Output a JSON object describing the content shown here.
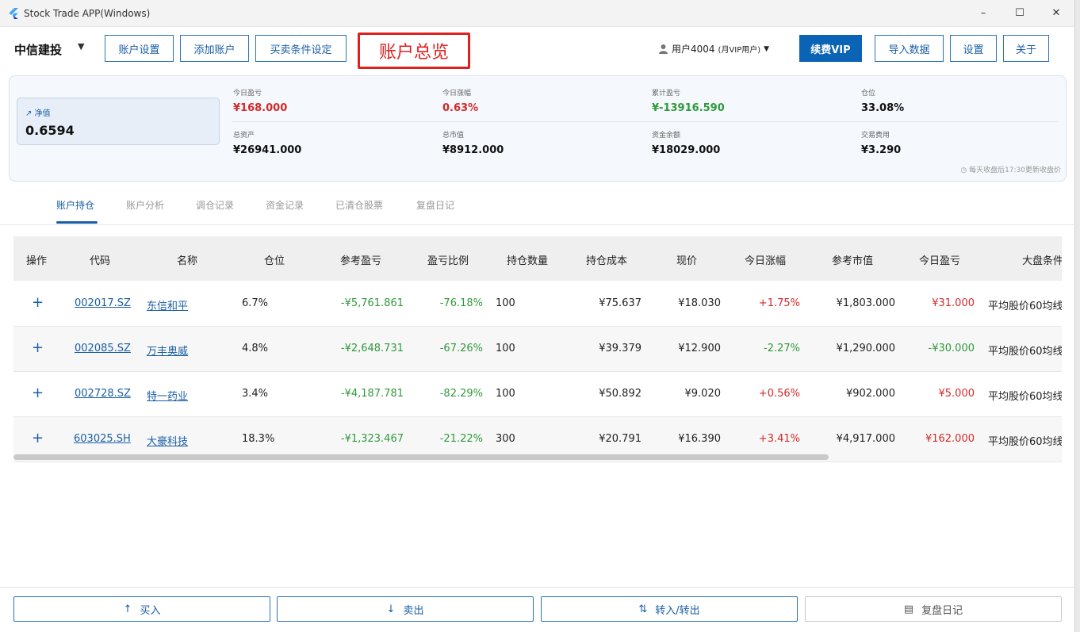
{
  "window": {
    "title": "Stock Trade APP(Windows)",
    "controls": {
      "minimize": "–",
      "maximize": "☐",
      "close": "✕"
    }
  },
  "header": {
    "broker": "中信建投",
    "buttons": {
      "account_settings": "账户设置",
      "add_account": "添加账户",
      "trade_conditions": "买卖条件设定",
      "renew_vip": "续费VIP",
      "import_data": "导入数据",
      "settings": "设置",
      "about": "关于"
    },
    "overview_label": "账户总览",
    "user": {
      "name": "用户4004",
      "tier": "(月VIP用户)"
    }
  },
  "summary": {
    "net_value": {
      "label": "净值",
      "value": "0.6594"
    },
    "metrics": [
      {
        "label": "今日盈亏",
        "value": "¥168.000"
      },
      {
        "label": "今日涨幅",
        "value": "0.63%"
      },
      {
        "label": "累计盈亏",
        "value": "¥-13916.590"
      },
      {
        "label": "仓位",
        "value": "33.08%"
      },
      {
        "label": "总资产",
        "value": "¥26941.000"
      },
      {
        "label": "总市值",
        "value": "¥8912.000"
      },
      {
        "label": "资金余额",
        "value": "¥18029.000"
      },
      {
        "label": "交易费用",
        "value": "¥3.290"
      }
    ],
    "update_note": "每天收盘后17:30更新收盘价"
  },
  "tabs": [
    "账户持仓",
    "账户分析",
    "调仓记录",
    "资金记录",
    "已清仓股票",
    "复盘日记"
  ],
  "table": {
    "headers": [
      "操作",
      "代码",
      "名称",
      "仓位",
      "参考盈亏",
      "盈亏比例",
      "持仓数量",
      "持仓成本",
      "现价",
      "今日涨幅",
      "参考市值",
      "今日盈亏",
      "大盘条件"
    ],
    "rows": [
      {
        "action": "+",
        "code": "002017.SZ",
        "name": "东信和平",
        "position": "6.7%",
        "pnl": "-¥5,761.861",
        "pnl_ratio": "-76.18%",
        "qty": "100",
        "cost": "¥75.637",
        "price": "¥18.030",
        "change": "+1.75%",
        "market_value": "¥1,803.000",
        "today_pnl": "¥31.000",
        "condition": "平均股价60均线"
      },
      {
        "action": "+",
        "code": "002085.SZ",
        "name": "万丰奥威",
        "position": "4.8%",
        "pnl": "-¥2,648.731",
        "pnl_ratio": "-67.26%",
        "qty": "100",
        "cost": "¥39.379",
        "price": "¥12.900",
        "change": "-2.27%",
        "market_value": "¥1,290.000",
        "today_pnl": "-¥30.000",
        "condition": "平均股价60均线"
      },
      {
        "action": "+",
        "code": "002728.SZ",
        "name": "特一药业",
        "position": "3.4%",
        "pnl": "-¥4,187.781",
        "pnl_ratio": "-82.29%",
        "qty": "100",
        "cost": "¥50.892",
        "price": "¥9.020",
        "change": "+0.56%",
        "market_value": "¥902.000",
        "today_pnl": "¥5.000",
        "condition": "平均股价60均线"
      },
      {
        "action": "+",
        "code": "603025.SH",
        "name": "大豪科技",
        "position": "18.3%",
        "pnl": "-¥1,323.467",
        "pnl_ratio": "-21.22%",
        "qty": "300",
        "cost": "¥20.791",
        "price": "¥16.390",
        "change": "+3.41%",
        "market_value": "¥4,917.000",
        "today_pnl": "¥162.000",
        "condition": "平均股价60均线"
      }
    ]
  },
  "bottom_buttons": {
    "buy": "买入",
    "sell": "卖出",
    "transfer": "转入/转出",
    "review": "复盘日记"
  },
  "colors": {
    "accent": "#0b63b5",
    "up": "#d42a2a",
    "down": "#2e9a3a",
    "highlight_box": "#e02020"
  }
}
